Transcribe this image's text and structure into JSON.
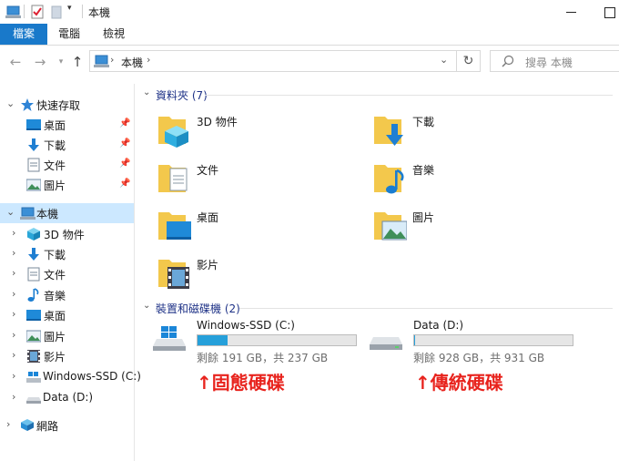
{
  "window": {
    "title": "本機",
    "controls": [
      "minimize",
      "maximize"
    ]
  },
  "ribbon": {
    "tabs": [
      {
        "label": "檔案",
        "active": true
      },
      {
        "label": "電腦"
      },
      {
        "label": "檢視"
      }
    ]
  },
  "address": {
    "location": "本機",
    "search_placeholder": "搜尋 本機"
  },
  "navpane": {
    "quick_access": "快速存取",
    "pinned": [
      "桌面",
      "下載",
      "文件",
      "圖片"
    ],
    "this_pc": "本機",
    "this_pc_children": [
      "3D 物件",
      "下載",
      "文件",
      "音樂",
      "桌面",
      "圖片",
      "影片",
      "Windows-SSD (C:)",
      "Data (D:)"
    ],
    "network": "網路"
  },
  "content": {
    "folders_header": "資料夾 (7)",
    "folders": [
      "3D 物件",
      "下載",
      "文件",
      "音樂",
      "桌面",
      "圖片",
      "影片"
    ],
    "devices_header": "裝置和磁碟機 (2)",
    "drives": [
      {
        "name": "Windows-SSD (C:)",
        "info": "剩餘 191 GB，共 237 GB",
        "used_fraction": 0.19
      },
      {
        "name": "Data (D:)",
        "info": "剩餘 928 GB，共 931 GB",
        "used_fraction": 0.003
      }
    ]
  },
  "annotations": {
    "ssd": "↑固態硬碟",
    "hdd": "↑傳統硬碟"
  },
  "colors": {
    "accent": "#1979ca",
    "selected": "#cce8ff",
    "drive_fill": "#26a0da",
    "annotation": "#e8231d",
    "folder": "#f3c84c"
  }
}
